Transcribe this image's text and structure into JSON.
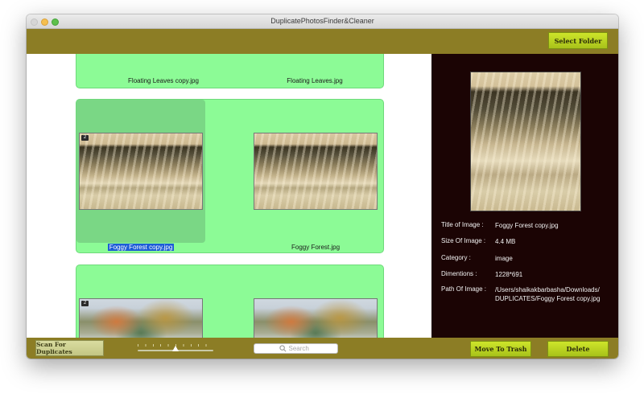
{
  "window": {
    "title": "DuplicatePhotosFinder&Cleaner"
  },
  "toolbar": {
    "select_folder_label": "Select Folder"
  },
  "groups": [
    {
      "files": [
        "Floating Leaves copy.jpg",
        "Floating Leaves.jpg"
      ]
    },
    {
      "files": [
        "Foggy Forest copy.jpg",
        "Foggy Forest.jpg"
      ],
      "badges": [
        "2"
      ],
      "selected_index": 0
    },
    {
      "files": [
        "",
        ""
      ],
      "badges": [
        "2"
      ]
    }
  ],
  "preview": {
    "details": [
      {
        "label": "Title of Image :",
        "value": "Foggy Forest copy.jpg"
      },
      {
        "label": "Size Of Image :",
        "value": "4.4 MB"
      },
      {
        "label": "Category      :",
        "value": "image"
      },
      {
        "label": "Dimentions     :",
        "value": "1228*691"
      },
      {
        "label": "Path Of Image :",
        "value": "/Users/shaikakbarbasha/Downloads/ DUPLICATES/Foggy Forest copy.jpg"
      }
    ]
  },
  "bottombar": {
    "scan_label": "Scan For Duplicates",
    "search_placeholder": "Search",
    "move_to_trash_label": "Move To Trash",
    "delete_label": "Delete",
    "thumbnail_size_level": 0.45
  },
  "colors": {
    "bar": "#8c7d25",
    "group_bg": "#8cfb96",
    "selected_cell": "#7ad785",
    "accent_button": "#c0d823",
    "preview_bg": "#1b0404",
    "selection": "#1d5cd6"
  }
}
